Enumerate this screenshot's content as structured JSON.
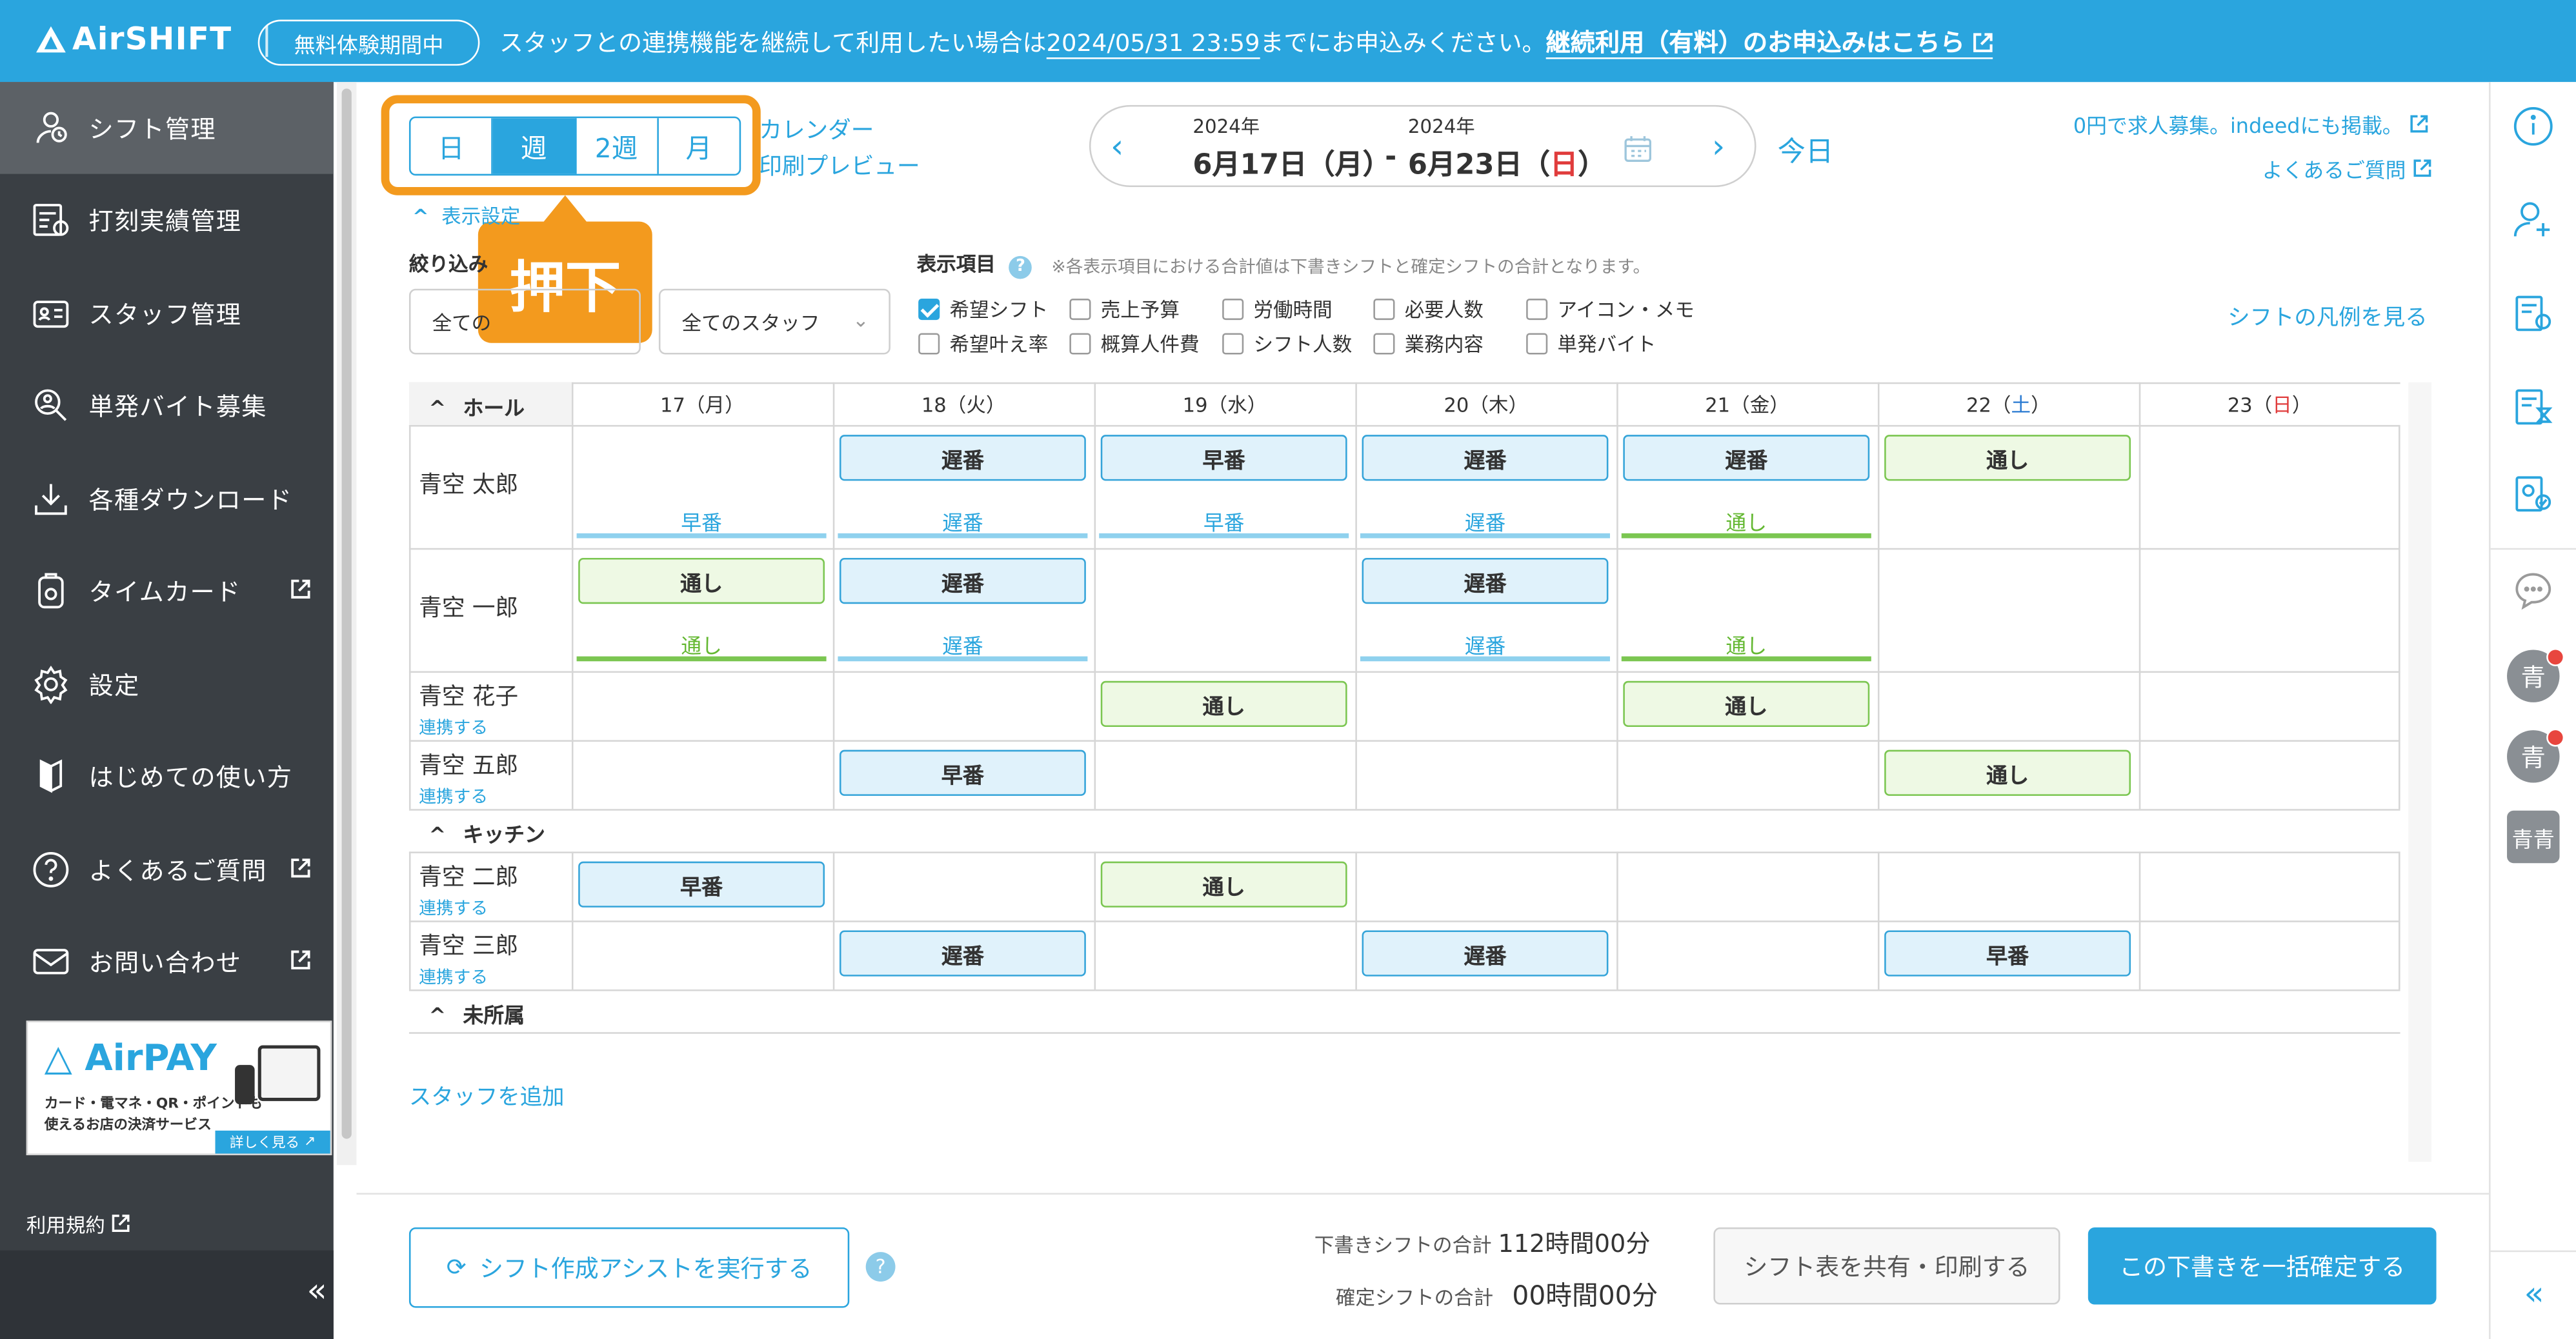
{
  "header": {
    "logo": "AirSHIFT",
    "trial_badge": "無料体験期間中",
    "notice_prefix": "スタッフとの連携機能を継続して利用したい場合は",
    "notice_deadline": "2024/05/31 23:59",
    "notice_suffix": "までにお申込みください。",
    "notice_link": "継続利用（有料）のお申込みはこちら"
  },
  "sidebar": {
    "items": [
      {
        "label": "シフト管理",
        "icon": "shift-icon"
      },
      {
        "label": "打刻実績管理",
        "icon": "punch-record-icon"
      },
      {
        "label": "スタッフ管理",
        "icon": "staff-card-icon"
      },
      {
        "label": "単発バイト募集",
        "icon": "recruit-search-icon"
      },
      {
        "label": "各種ダウンロード",
        "icon": "download-icon"
      },
      {
        "label": "タイムカード",
        "icon": "timecard-icon"
      },
      {
        "label": "設定",
        "icon": "gear-icon"
      },
      {
        "label": "はじめての使い方",
        "icon": "book-icon"
      },
      {
        "label": "よくあるご質問",
        "icon": "question-icon"
      },
      {
        "label": "お問い合わせ",
        "icon": "mail-icon"
      }
    ],
    "banner": {
      "title": "AirPAY",
      "line1": "カード・電マネ・QR・ポイントも",
      "line2": "使えるお店の決済サービス",
      "more": "詳しく見る"
    },
    "terms": "利用規約",
    "collapse": "«"
  },
  "toolbar": {
    "view_tabs": [
      "日",
      "週",
      "2週",
      "月"
    ],
    "selected_view": "週",
    "calendar_link": "カレンダー",
    "print_link": "印刷プレビュー",
    "callout": "押下",
    "display_settings": "表示設定",
    "filter_label": "絞り込み",
    "filter_group": "全ての",
    "filter_staff": "全てのスタッフ",
    "items_label": "表示項目",
    "items_note": "※各表示項目における合計値は下書きシフトと確定シフトの合計となります。",
    "options": [
      {
        "label": "希望シフト",
        "checked": true
      },
      {
        "label": "売上予算",
        "checked": false
      },
      {
        "label": "労働時間",
        "checked": false
      },
      {
        "label": "必要人数",
        "checked": false
      },
      {
        "label": "アイコン・メモ",
        "checked": false
      },
      {
        "label": "希望叶え率",
        "checked": false
      },
      {
        "label": "概算人件費",
        "checked": false
      },
      {
        "label": "シフト人数",
        "checked": false
      },
      {
        "label": "業務内容",
        "checked": false
      },
      {
        "label": "単発バイト",
        "checked": false
      }
    ],
    "legend_link": "シフトの凡例を見る",
    "recruit_link": "0円で求人募集。indeedにも掲載。",
    "faq_link": "よくあるご質問",
    "today": "今日"
  },
  "date_range": {
    "start_year": "2024年",
    "start": "6月17日（月）",
    "sep": "-",
    "end_year": "2024年",
    "end_prefix": "6月23日（",
    "end_day": "日",
    "end_suffix": "）"
  },
  "schedule": {
    "days": [
      {
        "num": "17",
        "wd": "月",
        "color": "#333333"
      },
      {
        "num": "18",
        "wd": "火",
        "color": "#333333"
      },
      {
        "num": "19",
        "wd": "水",
        "color": "#333333"
      },
      {
        "num": "20",
        "wd": "木",
        "color": "#333333"
      },
      {
        "num": "21",
        "wd": "金",
        "color": "#333333"
      },
      {
        "num": "22",
        "wd": "土",
        "color": "#2a7ad1"
      },
      {
        "num": "23",
        "wd": "日",
        "color": "#e03c3c"
      }
    ],
    "link_label": "連携する",
    "groups": [
      {
        "name": "ホール",
        "staff": [
          {
            "name": "青空 太郎",
            "linked": true,
            "cells": [
              {
                "shift": "",
                "wish": "早番"
              },
              {
                "shift": "遅番",
                "wish": "遅番"
              },
              {
                "shift": "早番",
                "wish": "早番"
              },
              {
                "shift": "遅番",
                "wish": "遅番"
              },
              {
                "shift": "遅番",
                "wish": "通し"
              },
              {
                "shift": "通し",
                "wish": ""
              },
              {
                "shift": "",
                "wish": ""
              }
            ]
          },
          {
            "name": "青空 一郎",
            "linked": true,
            "cells": [
              {
                "shift": "通し",
                "wish": "通し"
              },
              {
                "shift": "遅番",
                "wish": "遅番"
              },
              {
                "shift": "",
                "wish": ""
              },
              {
                "shift": "遅番",
                "wish": "遅番"
              },
              {
                "shift": "",
                "wish": "通し"
              },
              {
                "shift": "",
                "wish": ""
              },
              {
                "shift": "",
                "wish": ""
              }
            ]
          },
          {
            "name": "青空 花子",
            "linked": false,
            "cells": [
              {
                "shift": "",
                "wish": ""
              },
              {
                "shift": "",
                "wish": ""
              },
              {
                "shift": "通し",
                "wish": ""
              },
              {
                "shift": "",
                "wish": ""
              },
              {
                "shift": "通し",
                "wish": ""
              },
              {
                "shift": "",
                "wish": ""
              },
              {
                "shift": "",
                "wish": ""
              }
            ]
          },
          {
            "name": "青空 五郎",
            "linked": false,
            "cells": [
              {
                "shift": "",
                "wish": ""
              },
              {
                "shift": "早番",
                "wish": ""
              },
              {
                "shift": "",
                "wish": ""
              },
              {
                "shift": "",
                "wish": ""
              },
              {
                "shift": "",
                "wish": ""
              },
              {
                "shift": "通し",
                "wish": ""
              },
              {
                "shift": "",
                "wish": ""
              }
            ]
          }
        ]
      },
      {
        "name": "キッチン",
        "staff": [
          {
            "name": "青空 二郎",
            "linked": false,
            "cells": [
              {
                "shift": "早番",
                "wish": ""
              },
              {
                "shift": "",
                "wish": ""
              },
              {
                "shift": "通し",
                "wish": ""
              },
              {
                "shift": "",
                "wish": ""
              },
              {
                "shift": "",
                "wish": ""
              },
              {
                "shift": "",
                "wish": ""
              },
              {
                "shift": "",
                "wish": ""
              }
            ]
          },
          {
            "name": "青空 三郎",
            "linked": false,
            "cells": [
              {
                "shift": "",
                "wish": ""
              },
              {
                "shift": "遅番",
                "wish": ""
              },
              {
                "shift": "",
                "wish": ""
              },
              {
                "shift": "遅番",
                "wish": ""
              },
              {
                "shift": "",
                "wish": ""
              },
              {
                "shift": "早番",
                "wish": ""
              },
              {
                "shift": "",
                "wish": ""
              }
            ]
          }
        ]
      },
      {
        "name": "未所属",
        "staff": []
      }
    ],
    "add_staff": "スタッフを追加"
  },
  "footer": {
    "assist_button": "シフト作成アシストを実行する",
    "draft_label": "下書きシフトの合計",
    "draft_value": "112時間00分",
    "confirmed_label": "確定シフトの合計",
    "confirmed_value": "00時間00分",
    "share_button": "シフト表を共有・印刷する",
    "confirm_button": "この下書きを一括確定する"
  },
  "rail": {
    "avatars": [
      "青",
      "青",
      "青青"
    ]
  },
  "colors": {
    "brand": "#2aa5de",
    "sidebar": "#3a3f44",
    "highlight": "#f39a1e",
    "shift_blue": "#e0f2fb",
    "shift_green": "#eef9e4"
  }
}
